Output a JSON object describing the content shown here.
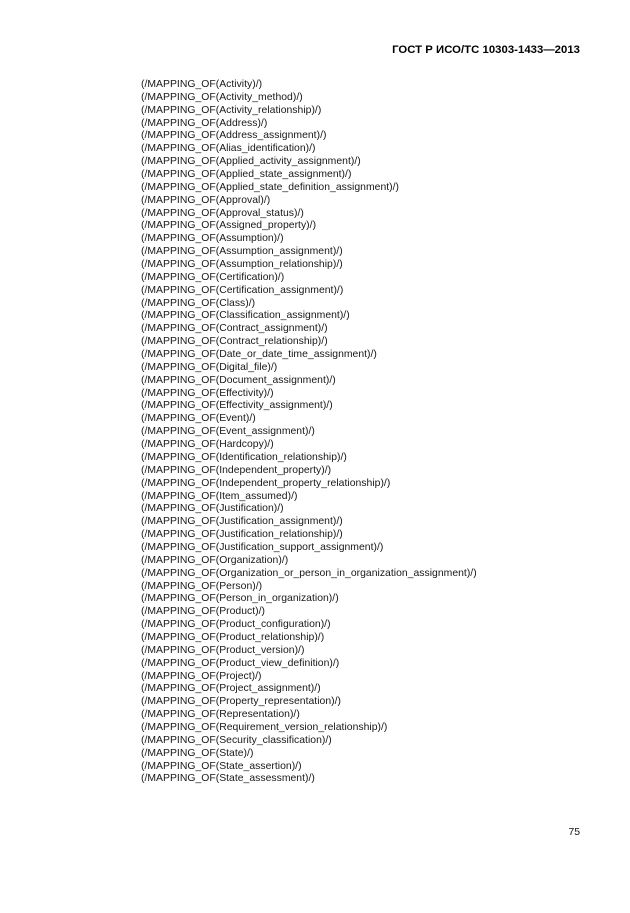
{
  "document": {
    "header_standard_title": "ГОСТ Р ИСО/ТС 10303-1433—2013",
    "page_number": "75",
    "mapping_lines": [
      "(/MAPPING_OF(Activity)/)",
      "(/MAPPING_OF(Activity_method)/)",
      "(/MAPPING_OF(Activity_relationship)/)",
      "(/MAPPING_OF(Address)/)",
      "(/MAPPING_OF(Address_assignment)/)",
      "(/MAPPING_OF(Alias_identification)/)",
      "(/MAPPING_OF(Applied_activity_assignment)/)",
      "(/MAPPING_OF(Applied_state_assignment)/)",
      "(/MAPPING_OF(Applied_state_definition_assignment)/)",
      "(/MAPPING_OF(Approval)/)",
      "(/MAPPING_OF(Approval_status)/)",
      "(/MAPPING_OF(Assigned_property)/)",
      "(/MAPPING_OF(Assumption)/)",
      "(/MAPPING_OF(Assumption_assignment)/)",
      "(/MAPPING_OF(Assumption_relationship)/)",
      "(/MAPPING_OF(Certification)/)",
      "(/MAPPING_OF(Certification_assignment)/)",
      "(/MAPPING_OF(Class)/)",
      "(/MAPPING_OF(Classification_assignment)/)",
      "(/MAPPING_OF(Contract_assignment)/)",
      "(/MAPPING_OF(Contract_relationship)/)",
      "(/MAPPING_OF(Date_or_date_time_assignment)/)",
      "(/MAPPING_OF(Digital_file)/)",
      "(/MAPPING_OF(Document_assignment)/)",
      "(/MAPPING_OF(Effectivity)/)",
      "(/MAPPING_OF(Effectivity_assignment)/)",
      "(/MAPPING_OF(Event)/)",
      "(/MAPPING_OF(Event_assignment)/)",
      "(/MAPPING_OF(Hardcopy)/)",
      "(/MAPPING_OF(Identification_relationship)/)",
      "(/MAPPING_OF(Independent_property)/)",
      "(/MAPPING_OF(Independent_property_relationship)/)",
      "(/MAPPING_OF(Item_assumed)/)",
      "(/MAPPING_OF(Justification)/)",
      "(/MAPPING_OF(Justification_assignment)/)",
      "(/MAPPING_OF(Justification_relationship)/)",
      "(/MAPPING_OF(Justification_support_assignment)/)",
      "(/MAPPING_OF(Organization)/)",
      "(/MAPPING_OF(Organization_or_person_in_organization_assignment)/)",
      "(/MAPPING_OF(Person)/)",
      "(/MAPPING_OF(Person_in_organization)/)",
      "(/MAPPING_OF(Product)/)",
      "(/MAPPING_OF(Product_configuration)/)",
      "(/MAPPING_OF(Product_relationship)/)",
      "(/MAPPING_OF(Product_version)/)",
      "(/MAPPING_OF(Product_view_definition)/)",
      "(/MAPPING_OF(Project)/)",
      "(/MAPPING_OF(Project_assignment)/)",
      "(/MAPPING_OF(Property_representation)/)",
      "(/MAPPING_OF(Representation)/)",
      "(/MAPPING_OF(Requirement_version_relationship)/)",
      "(/MAPPING_OF(Security_classification)/)",
      "(/MAPPING_OF(State)/)",
      "(/MAPPING_OF(State_assertion)/)",
      "(/MAPPING_OF(State_assessment)/)"
    ]
  }
}
